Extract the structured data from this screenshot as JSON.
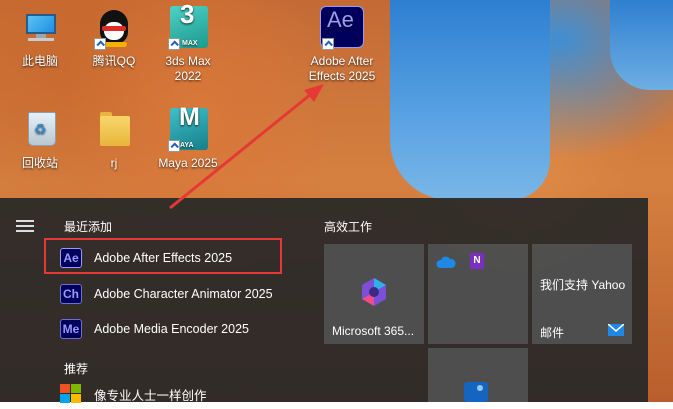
{
  "desktop": {
    "icons": [
      {
        "label": "此电脑",
        "icon": "computer-icon"
      },
      {
        "label": "腾讯QQ",
        "icon": "qq-icon"
      },
      {
        "label": "3ds Max 2022",
        "icon": "3dsmax-icon",
        "badge_num": "3",
        "badge_text": "MAX"
      },
      {
        "label": "Adobe After Effects 2025",
        "icon": "after-effects-icon",
        "badge_text": "Ae"
      },
      {
        "label": "回收站",
        "icon": "recycle-bin-icon"
      },
      {
        "label": "rj",
        "icon": "folder-icon"
      },
      {
        "label": "Maya 2025",
        "icon": "maya-icon",
        "badge_num": "M",
        "badge_text": "AYA"
      }
    ]
  },
  "start_menu": {
    "recent_title": "最近添加",
    "recent_apps": [
      {
        "label": "Adobe After Effects 2025",
        "abbr": "Ae",
        "icon": "after-effects-icon"
      },
      {
        "label": "Adobe Character Animator 2025",
        "abbr": "Ch",
        "icon": "character-animator-icon"
      },
      {
        "label": "Adobe Media Encoder 2025",
        "abbr": "Me",
        "icon": "media-encoder-icon"
      }
    ],
    "recommended_title": "推荐",
    "recommended_apps": [
      {
        "label": "像专业人士一样创作",
        "icon": "microsoft-office-icon"
      }
    ],
    "pinned_title": "高效工作",
    "tiles": {
      "m365": {
        "label": "Microsoft 365...",
        "icon": "microsoft-365-icon"
      },
      "mail": {
        "label": "我们支持 Yahoo",
        "sub_label": "邮件",
        "icon": "mail-icon"
      }
    }
  },
  "colors": {
    "highlight": "#e53935",
    "ae_bg": "#00005b",
    "ae_fg": "#9999ff",
    "menu_bg": "#282828"
  }
}
